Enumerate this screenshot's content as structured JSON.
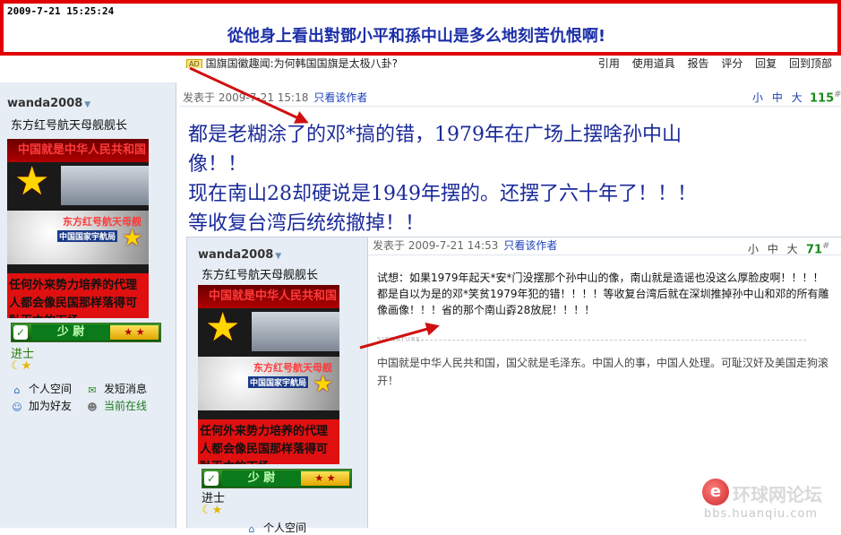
{
  "banner": {
    "timestamp": "2009-7-21 15:25:24",
    "title": "從他身上看出對鄧小平和孫中山是多么地刻苦仇恨啊!"
  },
  "strip": {
    "ad_badge": "AD",
    "thread_title": "国旗国徽趣闻:为何韩国国旗是太极八卦?",
    "tools": "引用 使用道具 报告 评分 回复 回到顶部"
  },
  "user": {
    "name": "wanda2008",
    "title": "东方红号航天母舰舰长",
    "avatar": {
      "top_text": "中国就是中华人民共和国",
      "ship_text": "东方红号航天母舰",
      "bureau_text": "中国国家宇航局",
      "bottom_text": "任何外来势力培养的代理人都会像民国那样落得可耻灭亡的下场"
    },
    "rank_label": "少 尉",
    "rank_name": "进士",
    "stars": "☾★",
    "links": {
      "space": "个人空间",
      "message": "发短消息",
      "add_friend": "加为好友",
      "status": "当前在线"
    }
  },
  "post": {
    "posted_label": "发表于",
    "posted_time": "2009-7-21 15:18",
    "only_author": "只看该作者",
    "size_tools": "小 中 大",
    "floor": "115",
    "floor_mark": "#",
    "body_lines": [
      "都是老糊涂了的邓*搞的错，1979年在广场上摆啥孙中山",
      "像！！",
      "现在南山28却硬说是1949年摆的。还摆了六十年了！！！",
      "等收复台湾后统统撤掉！！"
    ]
  },
  "quote": {
    "posted_label": "发表于",
    "posted_time": "2009-7-21 14:53",
    "only_author": "只看该作者",
    "size_tools": "小 中 大",
    "floor": "71",
    "floor_mark": "#",
    "body": "试想：如果1979年起天*安*门没摆那个孙中山的像，南山就是造谣也没这么厚脸皮啊！！！！都是自以为是的邓*笑贫1979年犯的错！！！！等收复台湾后就在深圳推掉孙中山和邓的所有雕像画像！！！省的那个南山孬28放屁！！！！",
    "signature_label": "SIGNATURE:",
    "signature": "中国就是中华人民共和国，国父就是毛泽东。中国人的事，中国人处理。可耻汉奸及美国走狗滚开！",
    "last_link": "个人空间"
  },
  "watermark": {
    "name": "环球网论坛",
    "url": "bbs.huanqiu.com"
  },
  "colors": {
    "banner_border": "#e00000",
    "banner_title": "#1c2fa8",
    "post_text": "#1a2a9a",
    "floor": "#1c8a1c",
    "arrow": "#d01010",
    "sidebar_bg": "#e6edf4"
  }
}
